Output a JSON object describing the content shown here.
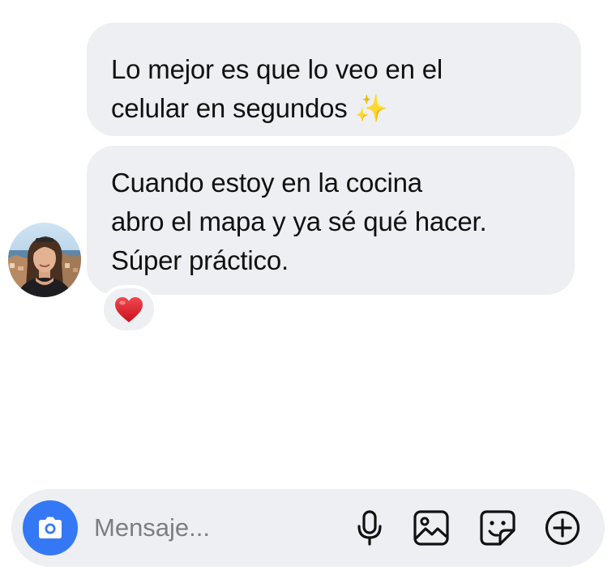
{
  "messages": [
    {
      "lines": [
        "Lo mejor es que lo veo en el",
        "celular en segundos"
      ],
      "emoji": "✨"
    },
    {
      "lines": [
        "Cuando estoy en la cocina",
        "abro el mapa y ya sé qué hacer.",
        "Súper práctico."
      ],
      "reaction": "❤️"
    }
  ],
  "composer": {
    "placeholder": "Mensaje..."
  },
  "icons": {
    "camera": "camera-icon",
    "microphone": "microphone-icon",
    "gallery": "image-icon",
    "sticker": "sticker-icon",
    "add": "plus-circle-icon"
  },
  "colors": {
    "bubble": "#eeeff2",
    "accent": "#3478f6",
    "text": "#111111",
    "placeholder": "#7d7d82"
  }
}
